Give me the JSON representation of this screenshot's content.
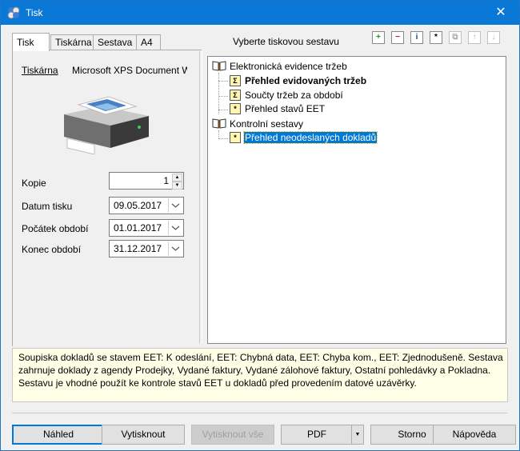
{
  "window": {
    "title": "Tisk",
    "close_glyph": "✕"
  },
  "tabs": [
    {
      "label": "Tisk"
    },
    {
      "label": "Tiskárna"
    },
    {
      "label": "Sestava"
    },
    {
      "label": "A4"
    }
  ],
  "printer": {
    "label": "Tiskárna",
    "value": "Microsoft XPS Document W"
  },
  "fields": {
    "copies": {
      "label": "Kopie",
      "value": "1"
    },
    "print_date": {
      "label": "Datum tisku",
      "value": "09.05.2017"
    },
    "period_start": {
      "label": "Počátek období",
      "value": "01.01.2017"
    },
    "period_end": {
      "label": "Konec období",
      "value": "31.12.2017"
    }
  },
  "report_header": "Vyberte tiskovou sestavu",
  "toolbar_icons": [
    "add-icon",
    "remove-icon",
    "info-icon",
    "edit-icon",
    "copy-icon",
    "move-up-icon",
    "move-down-icon"
  ],
  "tree": {
    "groups": [
      {
        "label": "Elektronická evidence tržeb",
        "items": [
          {
            "label": "Přehled evidovaných tržeb",
            "icon": "sigma-icon",
            "glyph": "Σ"
          },
          {
            "label": "Součty tržeb za období",
            "icon": "sigma-icon",
            "glyph": "Σ"
          },
          {
            "label": "Přehled stavů EET",
            "icon": "star-report-icon",
            "glyph": "*"
          }
        ]
      },
      {
        "label": "Kontrolní sestavy",
        "items": [
          {
            "label": "Přehled neodeslaných dokladů",
            "icon": "star-report-icon",
            "glyph": "*"
          }
        ]
      }
    ]
  },
  "description": [
    "Soupiska dokladů se stavem EET: K odeslání, EET: Chybná data, EET: Chyba kom., EET: Zjednodušeně. Sestava",
    "zahrnuje doklady z agendy Prodejky, Vydané faktury, Vydané zálohové faktury, Ostatní pohledávky a Pokladna.",
    "Sestavu je vhodné použít ke kontrole stavů EET u dokladů před provedením datové uzávěrky."
  ],
  "buttons": {
    "preview": "Náhled",
    "print": "Vytisknout",
    "print_all": "Vytisknout vše",
    "pdf": "PDF",
    "cancel": "Storno",
    "help": "Nápověda"
  },
  "colors": {
    "accent": "#0078d7",
    "titlebar": "#0a78d7",
    "description_bg": "#ffffe8"
  }
}
